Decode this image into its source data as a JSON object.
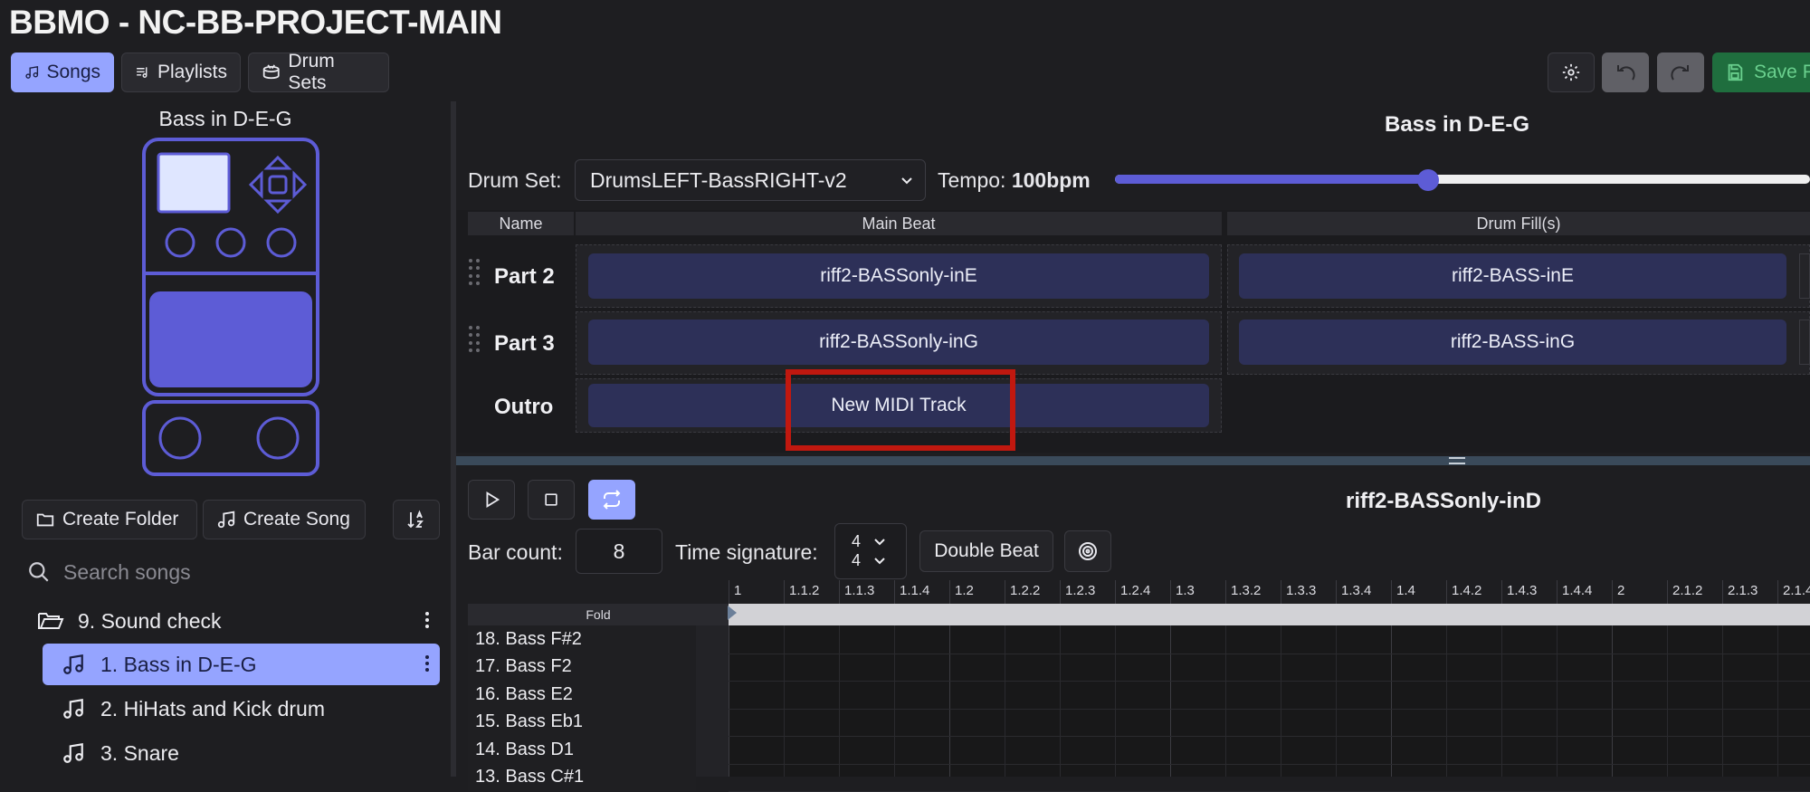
{
  "app": {
    "title": "BBMO - NC-BB-PROJECT-MAIN"
  },
  "nav": {
    "songs": "Songs",
    "playlists": "Playlists",
    "drum_sets": "Drum Sets",
    "save_label": "Save P"
  },
  "sidebar": {
    "song_title": "Bass in D-E-G",
    "create_folder": "Create Folder",
    "create_song": "Create Song",
    "search_placeholder": "Search songs",
    "folder": "9. Sound check",
    "songs": [
      {
        "label": "1. Bass in D-E-G",
        "selected": true
      },
      {
        "label": "2. HiHats and Kick drum",
        "selected": false
      },
      {
        "label": "3. Snare",
        "selected": false
      }
    ]
  },
  "main": {
    "title": "Bass in D-E-G",
    "drum_set_label": "Drum Set:",
    "drum_set_value": "DrumsLEFT-BassRIGHT-v2",
    "tempo_label": "Tempo:",
    "tempo_value": "100bpm",
    "tempo_fraction": 0.45,
    "columns": {
      "name": "Name",
      "main_beat": "Main Beat",
      "drum_fills": "Drum Fill(s)"
    },
    "parts": [
      {
        "name": "Part 2",
        "main_beat": "riff2-BASSonly-inE",
        "fill": "riff2-BASS-inE"
      },
      {
        "name": "Part 3",
        "main_beat": "riff2-BASSonly-inG",
        "fill": "riff2-BASS-inG"
      },
      {
        "name": "Outro",
        "main_beat": "New MIDI Track",
        "fill": ""
      }
    ]
  },
  "editor": {
    "track_title": "riff2-BASSonly-inD",
    "bar_count_label": "Bar count:",
    "bar_count_value": "8",
    "time_sig_label": "Time signature:",
    "time_sig_num": "4",
    "time_sig_den": "4",
    "double_beat": "Double Beat",
    "fold_label": "Fold",
    "ruler": [
      "1",
      "1.1.2",
      "1.1.3",
      "1.1.4",
      "1.2",
      "1.2.2",
      "1.2.3",
      "1.2.4",
      "1.3",
      "1.3.2",
      "1.3.3",
      "1.3.4",
      "1.4",
      "1.4.2",
      "1.4.3",
      "1.4.4",
      "2",
      "2.1.2",
      "2.1.3",
      "2.1.4"
    ],
    "instruments": [
      "18. Bass F#2",
      "17. Bass F2",
      "16. Bass E2",
      "15. Bass Eb1",
      "14. Bass D1",
      "13. Bass C#1"
    ]
  },
  "colors": {
    "accent": "#95a4ff",
    "pedal": "#5d5cd6",
    "highlight_box": "#c0180f",
    "save_green": "#1f6e3e"
  }
}
